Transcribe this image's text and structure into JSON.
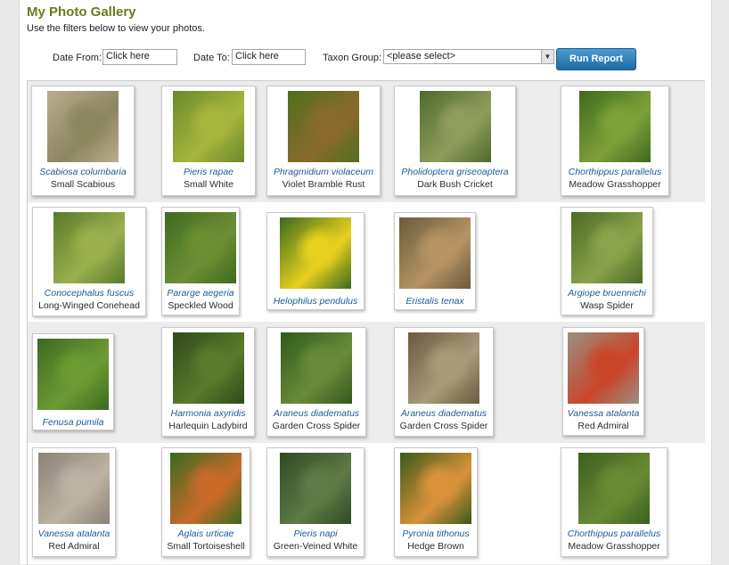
{
  "page": {
    "title": "My Photo Gallery",
    "subtitle": "Use the filters below to view your photos."
  },
  "filters": {
    "date_from_label": "Date From:",
    "date_from_value": "Click here",
    "date_to_label": "Date To:",
    "date_to_value": "Click here",
    "taxon_label": "Taxon Group:",
    "taxon_value": "<please select>",
    "run_button": "Run Report"
  },
  "photos": [
    {
      "latin": "Scabiosa columbaria",
      "common": "Small Scabious",
      "colors": [
        "#b9ad8e",
        "#8c8660"
      ]
    },
    {
      "latin": "Pieris rapae",
      "common": "Small White",
      "colors": [
        "#6b8a2a",
        "#a6b53c"
      ]
    },
    {
      "latin": "Phragmidium violaceum",
      "common": "Violet Bramble Rust",
      "colors": [
        "#4f6f1f",
        "#8a6a2c"
      ]
    },
    {
      "latin": "Pholidoptera griseoaptera",
      "common": "Dark Bush Cricket",
      "colors": [
        "#4e6a2c",
        "#8f9c5c"
      ]
    },
    {
      "latin": "Chorthippus parallelus",
      "common": "Meadow Grasshopper",
      "colors": [
        "#3f6a1f",
        "#7ea03a"
      ]
    },
    {
      "latin": "Conocephalus fuscus",
      "common": "Long-Winged Conehead",
      "colors": [
        "#5a7a2a",
        "#9bb04d"
      ]
    },
    {
      "latin": "Pararge aegeria",
      "common": "Speckled Wood",
      "colors": [
        "#3e6b22",
        "#6e8e34"
      ]
    },
    {
      "latin": "Helophilus pendulus",
      "common": "",
      "colors": [
        "#3d6a1f",
        "#e8d01e"
      ]
    },
    {
      "latin": "Eristalis tenax",
      "common": "",
      "colors": [
        "#6a5a3a",
        "#b69464"
      ]
    },
    {
      "latin": "Argiope bruennichi",
      "common": "Wasp Spider",
      "colors": [
        "#4b6a26",
        "#8aa24a"
      ]
    },
    {
      "latin": "Fenusa pumila",
      "common": "",
      "colors": [
        "#3c6a20",
        "#6e9a34"
      ]
    },
    {
      "latin": "Harmonia axyridis",
      "common": "Harlequin Ladybird",
      "colors": [
        "#2f4a1a",
        "#5a7a2c"
      ]
    },
    {
      "latin": "Araneus diadematus",
      "common": "Garden Cross Spider",
      "colors": [
        "#2f5a1c",
        "#6a8a3a"
      ]
    },
    {
      "latin": "Araneus diadematus",
      "common": "Garden Cross Spider",
      "colors": [
        "#6a5a3e",
        "#a89a7a"
      ]
    },
    {
      "latin": "Vanessa atalanta",
      "common": "Red Admiral",
      "colors": [
        "#9a9080",
        "#c9452a"
      ]
    },
    {
      "latin": "Vanessa atalanta",
      "common": "Red Admiral",
      "colors": [
        "#8a8278",
        "#bdb3a3"
      ]
    },
    {
      "latin": "Aglais urticae",
      "common": "Small Tortoiseshell",
      "colors": [
        "#3a6a20",
        "#c86a2a"
      ]
    },
    {
      "latin": "Pieris napi",
      "common": "Green-Veined White",
      "colors": [
        "#2f4a22",
        "#5f7a46"
      ]
    },
    {
      "latin": "Pyronia tithonus",
      "common": "Hedge Brown",
      "colors": [
        "#3a5a1a",
        "#d9923a"
      ]
    },
    {
      "latin": "Chorthippus parallelus",
      "common": "Meadow Grasshopper",
      "colors": [
        "#3a6020",
        "#6a8a34"
      ]
    }
  ]
}
